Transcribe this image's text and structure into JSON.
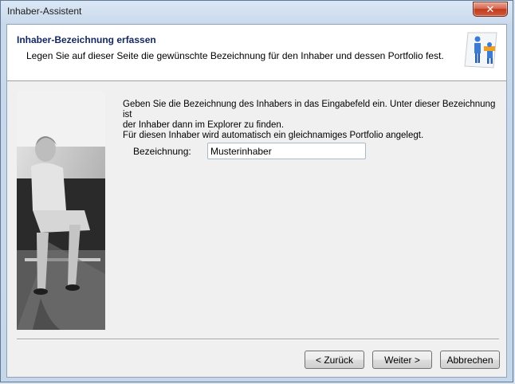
{
  "window": {
    "title": "Inhaber-Assistent",
    "close_glyph": "✕"
  },
  "header": {
    "title": "Inhaber-Bezeichnung erfassen",
    "subtitle": "Legen Sie auf dieser Seite die gewünschte Bezeichnung für den Inhaber und dessen Portfolio fest.",
    "logo_icon": "owner-portfolio-icon"
  },
  "content": {
    "intro_line1": "Geben Sie die Bezeichnung des Inhabers in das Eingabefeld ein. Unter dieser Bezeichnung ist",
    "intro_line2": "der Inhaber dann im Explorer zu finden.",
    "intro_line3": "Für diesen Inhaber wird automatisch ein gleichnamiges Portfolio angelegt.",
    "field_label": "Bezeichnung:",
    "field_value": "Musterinhaber"
  },
  "buttons": {
    "back": "< Zurück",
    "next": "Weiter >",
    "cancel": "Abbrechen"
  },
  "colors": {
    "header_title": "#11275e",
    "close_button": "#c23a1f"
  }
}
